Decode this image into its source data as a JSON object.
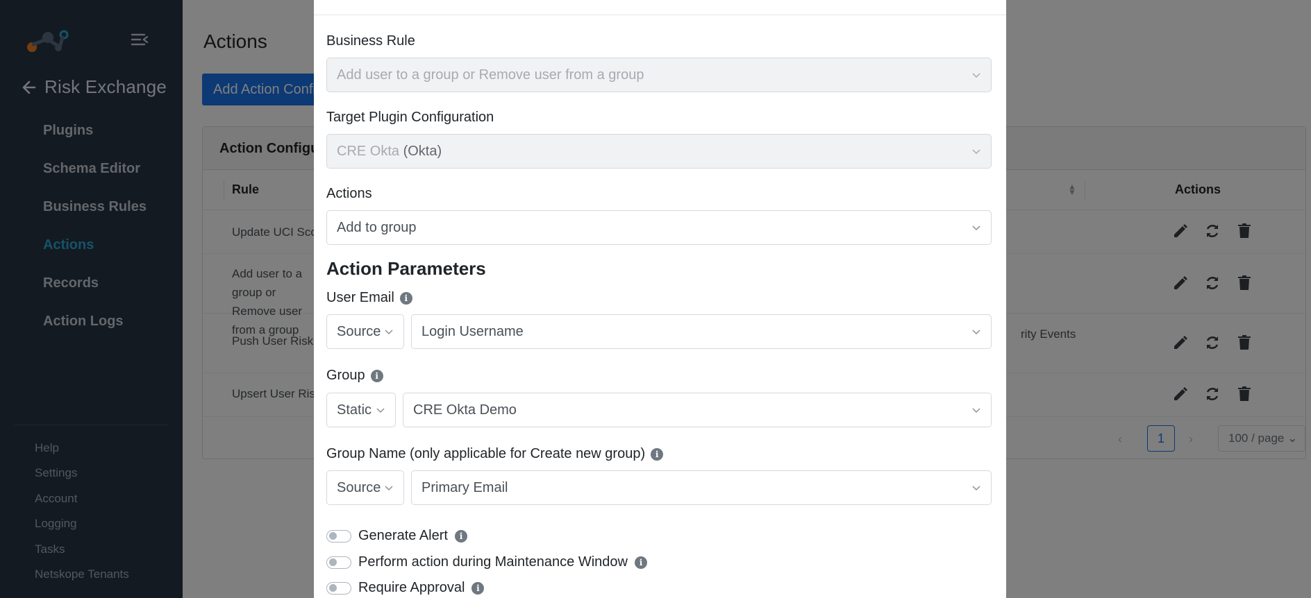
{
  "sidebar": {
    "back_title": "Risk Exchange",
    "nav": [
      {
        "label": "Plugins",
        "active": false
      },
      {
        "label": "Schema Editor",
        "active": false
      },
      {
        "label": "Business Rules",
        "active": false
      },
      {
        "label": "Actions",
        "active": true
      },
      {
        "label": "Records",
        "active": false
      },
      {
        "label": "Action Logs",
        "active": false
      }
    ],
    "footer": [
      "Help",
      "Settings",
      "Account",
      "Logging",
      "Tasks",
      "Netskope Tenants"
    ]
  },
  "page": {
    "title": "Actions",
    "add_button": "Add Action Configuration",
    "card_title": "Action Configurations",
    "columns": {
      "rule": "Rule",
      "actions": "Actions"
    },
    "rows": [
      {
        "rule": "Update UCI Score",
        "extra": ""
      },
      {
        "rule": "Add user to a group or Remove user from a group",
        "extra": ""
      },
      {
        "rule": "Push User Risk",
        "extra": "rity Events"
      },
      {
        "rule": "Upsert User Risk",
        "extra": ""
      }
    ],
    "pagination": {
      "current": "1",
      "page_size": "100 / page"
    }
  },
  "modal": {
    "business_rule": {
      "label": "Business Rule",
      "value": "Add user to a group or Remove user from a group"
    },
    "target_plugin": {
      "label": "Target Plugin Configuration",
      "value": "CRE Okta",
      "suffix": "(Okta)"
    },
    "actions": {
      "label": "Actions",
      "value": "Add to group"
    },
    "section_title": "Action Parameters",
    "user_email": {
      "label": "User Email",
      "type": "Source",
      "value": "Login Username"
    },
    "group": {
      "label": "Group",
      "type": "Static",
      "value": "CRE Okta Demo"
    },
    "group_name": {
      "label": "Group Name (only applicable for Create new group)",
      "type": "Source",
      "value": "Primary Email"
    },
    "toggles": [
      {
        "label": "Generate Alert",
        "on": false
      },
      {
        "label": "Perform action during Maintenance Window",
        "on": false
      },
      {
        "label": "Require Approval",
        "on": false
      }
    ]
  },
  "colors": {
    "sidebar_bg": "#293444",
    "active_nav": "#2aa6cf",
    "primary": "#1a73e8"
  }
}
